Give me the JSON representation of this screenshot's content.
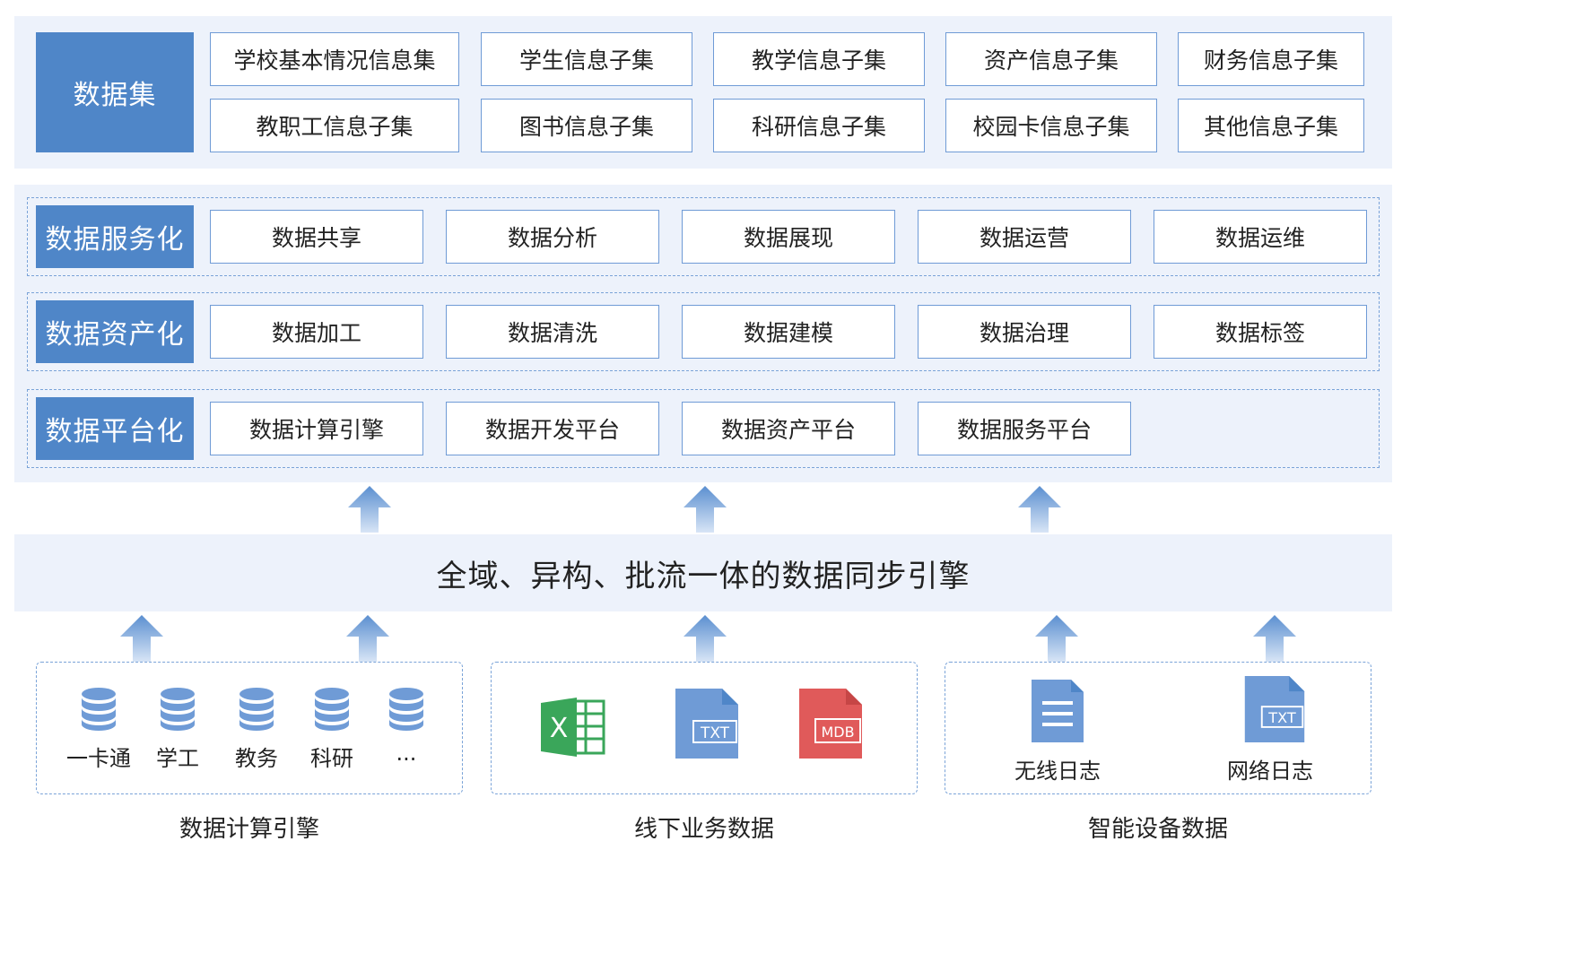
{
  "dataset": {
    "header": "数据集",
    "items": [
      "学校基本情况信息集",
      "学生信息子集",
      "教学信息子集",
      "资产信息子集",
      "财务信息子集",
      "教职工信息子集",
      "图书信息子集",
      "科研信息子集",
      "校园卡信息子集",
      "其他信息子集"
    ]
  },
  "rows": [
    {
      "header": "数据服务化",
      "items": [
        "数据共享",
        "数据分析",
        "数据展现",
        "数据运营",
        "数据运维"
      ]
    },
    {
      "header": "数据资产化",
      "items": [
        "数据加工",
        "数据清洗",
        "数据建模",
        "数据治理",
        "数据标签"
      ]
    },
    {
      "header": "数据平台化",
      "items": [
        "数据计算引擎",
        "数据开发平台",
        "数据资产平台",
        "数据服务平台"
      ]
    }
  ],
  "engine": {
    "title": "全域、异构、批流一体的数据同步引擎"
  },
  "sources": [
    {
      "caption": "数据计算引擎",
      "items": [
        "一卡通",
        "学工",
        "教务",
        "科研",
        "..."
      ]
    },
    {
      "caption": "线下业务数据",
      "files": [
        {
          "icon": "excel-icon",
          "text": "X"
        },
        {
          "icon": "txt-file-icon",
          "text": "TXT"
        },
        {
          "icon": "mdb-file-icon",
          "text": "MDB"
        }
      ]
    },
    {
      "caption": "智能设备数据",
      "items": [
        "无线日志",
        "网络日志"
      ],
      "file_text": "TXT"
    }
  ],
  "colors": {
    "accent": "#4f86c8",
    "panel": "#edf2fb",
    "border": "#6f9bd6",
    "excel": "#3aa65a",
    "mdb": "#e05a5a",
    "db": "#6f9bd6"
  }
}
